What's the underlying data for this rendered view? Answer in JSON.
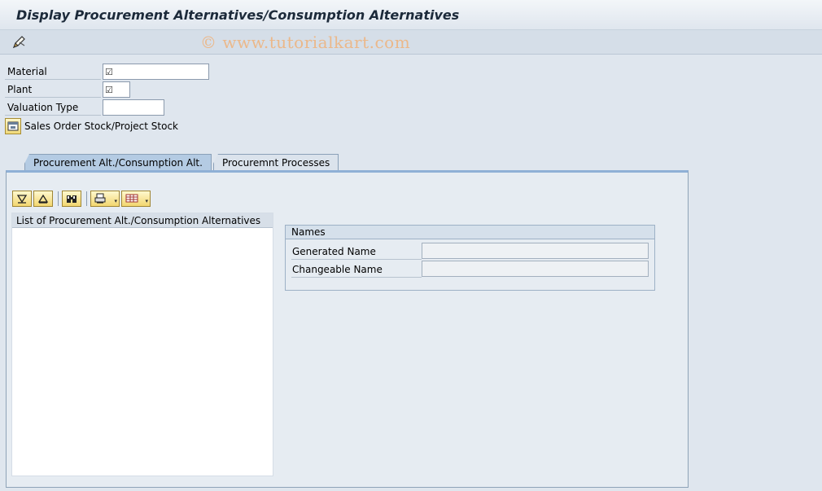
{
  "header": {
    "title": "Display Procurement Alternatives/Consumption Alternatives"
  },
  "toolbar": {
    "tools": [
      {
        "icon": "change-edit-icon"
      }
    ],
    "watermark": "© www.tutorialkart.com"
  },
  "fields": {
    "material": {
      "label": "Material",
      "value": "",
      "checked": true
    },
    "plant": {
      "label": "Plant",
      "value": "",
      "checked": true
    },
    "valuation_type": {
      "label": "Valuation Type",
      "value": ""
    }
  },
  "sales_order": {
    "label": "Sales Order Stock/Project Stock"
  },
  "tabs": [
    {
      "label": "Procurement Alt./Consumption Alt.",
      "active": true
    },
    {
      "label": "Procuremnt Processes",
      "active": false
    }
  ],
  "list": {
    "header": "List of Procurement Alt./Consumption Alternatives",
    "items": []
  },
  "names": {
    "title": "Names",
    "generated_name": {
      "label": "Generated Name",
      "value": ""
    },
    "changeable_name": {
      "label": "Changeable Name",
      "value": ""
    }
  },
  "colors": {
    "title_text": "#1c2a3a",
    "tab_active": "#b4cbe3",
    "button_yellow": "#f2d66f",
    "watermark": "#f0b27a"
  }
}
